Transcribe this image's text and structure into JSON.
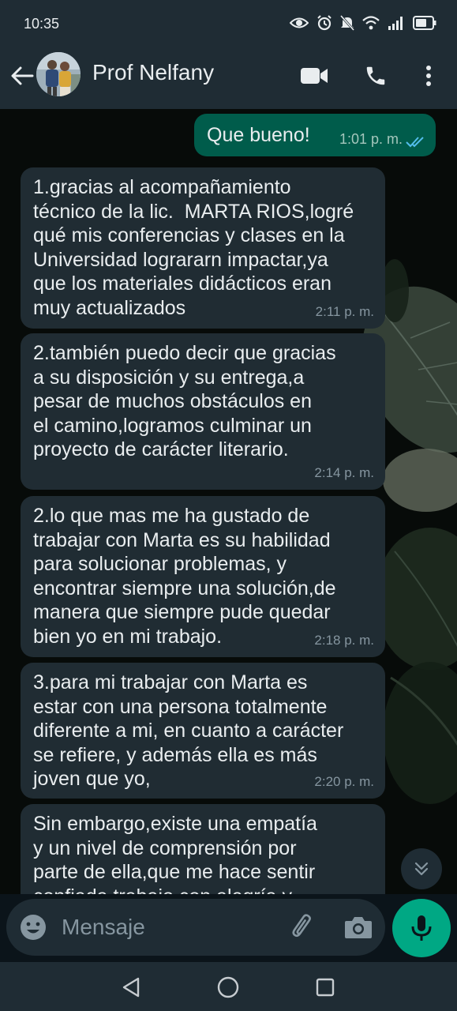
{
  "status_bar": {
    "time": "10:35"
  },
  "header": {
    "contact_name": "Prof Nelfany"
  },
  "messages": [
    {
      "direction": "out",
      "text": "Que bueno!",
      "time": "1:01 p. m.",
      "read": true
    },
    {
      "direction": "in",
      "text": "1.gracias al acompañamiento\ntécnico de la lic.  MARTA RIOS,logré\nqué mis conferencias y clases en la\nUniversidad logrararn impactar,ya\nque los materiales didácticos eran\nmuy actualizados",
      "time": "2:11 p. m."
    },
    {
      "direction": "in",
      "text": "2.también puedo decir que gracias\na su disposición y su entrega,a\npesar de muchos obstáculos en\nel camino,logramos culminar un\nproyecto de carácter literario.",
      "time": "2:14 p. m."
    },
    {
      "direction": "in",
      "text": "2.lo que mas me ha gustado de\ntrabajar con Marta es su habilidad\npara solucionar problemas, y\nencontrar siempre una solución,de\nmanera que siempre pude quedar\nbien yo en mi trabajo.",
      "time": "2:18 p. m."
    },
    {
      "direction": "in",
      "text": "3.para mi trabajar con Marta es\nestar con una persona totalmente\ndiferente a mi, en cuanto a carácter\nse refiere, y además ella es más\njoven que yo,",
      "time": "2:20 p. m."
    },
    {
      "direction": "in",
      "text": "Sin embargo,existe una empatía\ny un nivel de comprensión por\nparte de ella,que me hace sentir\nconfiada trabajo con alegría y",
      "time": ""
    }
  ],
  "composer": {
    "placeholder": "Mensaje"
  },
  "colors": {
    "outgoing_bubble": "#005c4b",
    "incoming_bubble": "#202c33",
    "accent": "#00a884",
    "read_ticks": "#53bdeb"
  },
  "icons": [
    "eye-icon",
    "alarm-icon",
    "mute-icon",
    "wifi-icon",
    "signal-icon",
    "battery-icon",
    "back-arrow-icon",
    "video-call-icon",
    "phone-icon",
    "more-vert-icon",
    "double-chevron-down-icon",
    "emoji-icon",
    "attach-icon",
    "camera-icon",
    "mic-icon",
    "nav-back-icon",
    "nav-home-icon",
    "nav-recents-icon"
  ]
}
